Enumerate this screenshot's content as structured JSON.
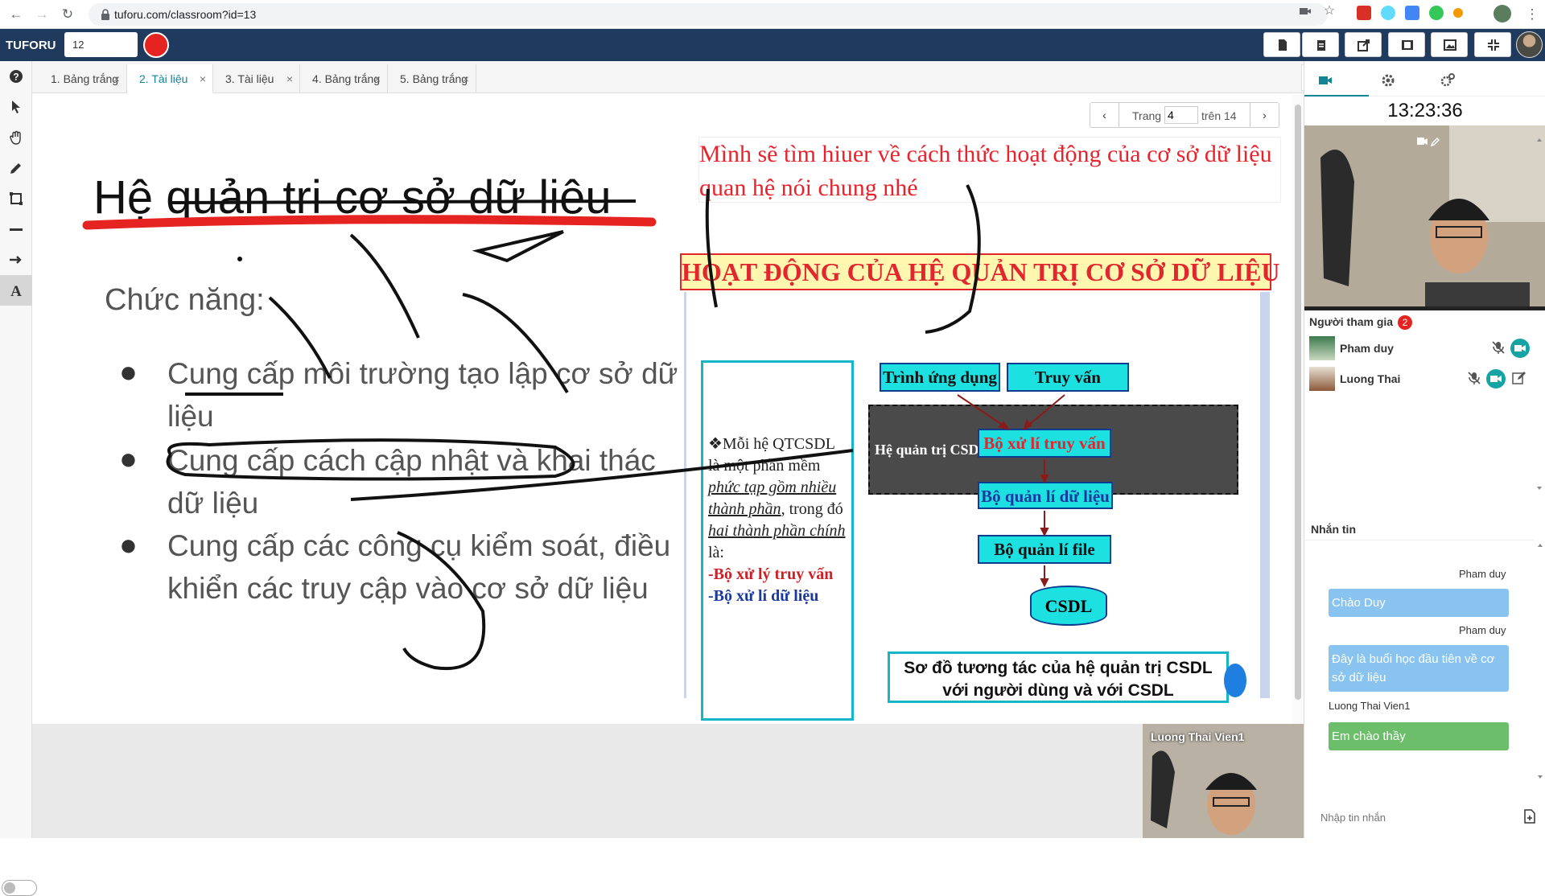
{
  "browser": {
    "url": "tuforu.com/classroom?id=13"
  },
  "app": {
    "brand": "TUFORU",
    "room_value": "12"
  },
  "tabs": [
    {
      "label": "1. Bảng trắng"
    },
    {
      "label": "2. Tài liệu"
    },
    {
      "label": "3. Tài liệu"
    },
    {
      "label": "4. Bảng trắng"
    },
    {
      "label": "5. Bảng trắng"
    }
  ],
  "pager": {
    "label": "Trang",
    "current": "4",
    "total": "trên 14"
  },
  "slide": {
    "title": "Hệ quản trị cơ sở dữ liệu",
    "subtitle": "Chức năng:",
    "bullets": [
      "Cung cấp môi trường tạo lập cơ sở dữ liệu",
      "Cung cấp cách cập nhật và khai thác dữ liệu",
      "Cung cấp các công cụ kiểm soát, điều khiển các truy cập vào cơ sở dữ liệu"
    ],
    "bullet_symbol": "●"
  },
  "note": "Mình sẽ tìm hiuer về cách thức hoạt động của cơ sở dữ liệu quan hệ nói chung nhé",
  "document": {
    "title": "HOẠT ĐỘNG CỦA HỆ QUẢN TRỊ CƠ SỞ DỮ LIỆU",
    "left_text": {
      "intro": "❖Mỗi hệ QTCSDL là một phần mềm",
      "u1": "phức tạp gồm nhiều thành phần",
      "mid": ", trong đó",
      "u2": "hai thành phần chính",
      "end": " là:",
      "red": "-Bộ xử lý truy vấn",
      "blue": "-Bộ xử lí dữ liệu"
    },
    "app_box": "Trình ứng dụng",
    "query_box": "Truy vấn",
    "dbms_label": "Hệ quản trị CSDL",
    "query_processor": "Bộ xử lí truy vấn",
    "data_manager": "Bộ quản lí dữ liệu",
    "file_manager": "Bộ quản lí file",
    "db": "CSDL",
    "caption": "Sơ đồ tương tác của hệ quản trị CSDL với người dùng và với CSDL"
  },
  "right": {
    "clock": "13:23:36",
    "participants_label": "Người tham gia",
    "participants_count": "2",
    "participants": [
      {
        "name": "Pham duy"
      },
      {
        "name": "Luong Thai"
      }
    ],
    "chat_label": "Nhắn tin",
    "messages": [
      {
        "sender": "Pham duy",
        "text": "Chào Duy"
      },
      {
        "sender": "Pham duy",
        "text": "Đây là buổi học đầu tiên về cơ sở dữ liệu"
      },
      {
        "sender": "Luong Thai Vien1",
        "text": "Em chào thầy"
      }
    ],
    "chat_placeholder": "Nhập tin nhắn"
  },
  "bottom_cam": {
    "name": "Luong Thai Vien1"
  },
  "colors": {
    "appbar": "#1f3a5c",
    "accent": "#138496",
    "record": "#e52421",
    "note_text": "#e8232b"
  }
}
